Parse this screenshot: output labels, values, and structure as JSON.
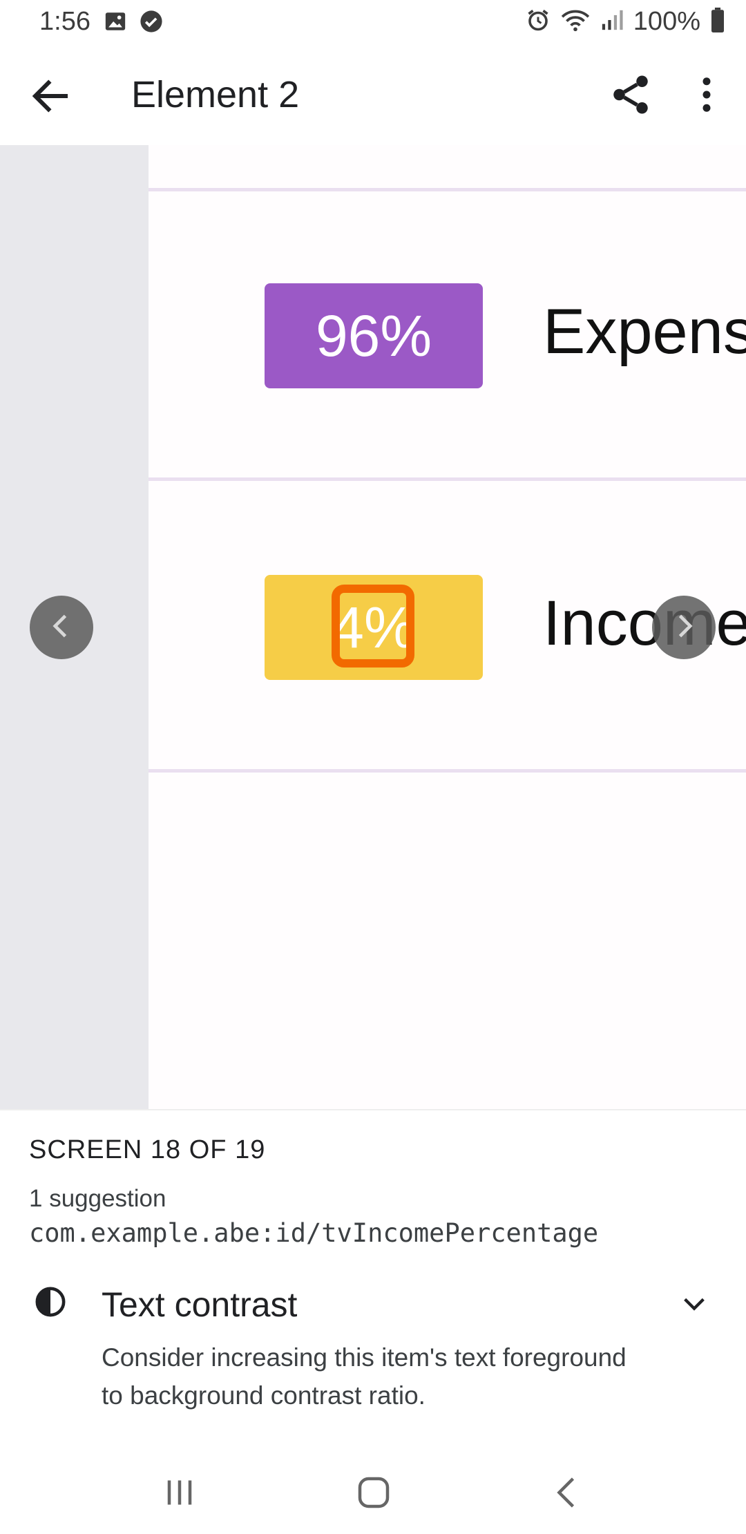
{
  "status_bar": {
    "time": "1:56",
    "battery": "100%"
  },
  "app_bar": {
    "title": "Element 2"
  },
  "preview": {
    "rows": [
      {
        "percentage": "96%",
        "label": "Expens",
        "badge_color": "#9b59c6"
      },
      {
        "percentage": "4%",
        "label": "Income",
        "badge_color": "#f6cd47"
      }
    ],
    "highlight_color": "#f26a00"
  },
  "sheet": {
    "screen_counter": "SCREEN 18 OF 19",
    "suggestion_count": "1 suggestion",
    "resource_id": "com.example.abe:id/tvIncomePercentage",
    "issue_title": "Text contrast",
    "issue_description": "Consider increasing this item's text foreground to background contrast ratio."
  }
}
